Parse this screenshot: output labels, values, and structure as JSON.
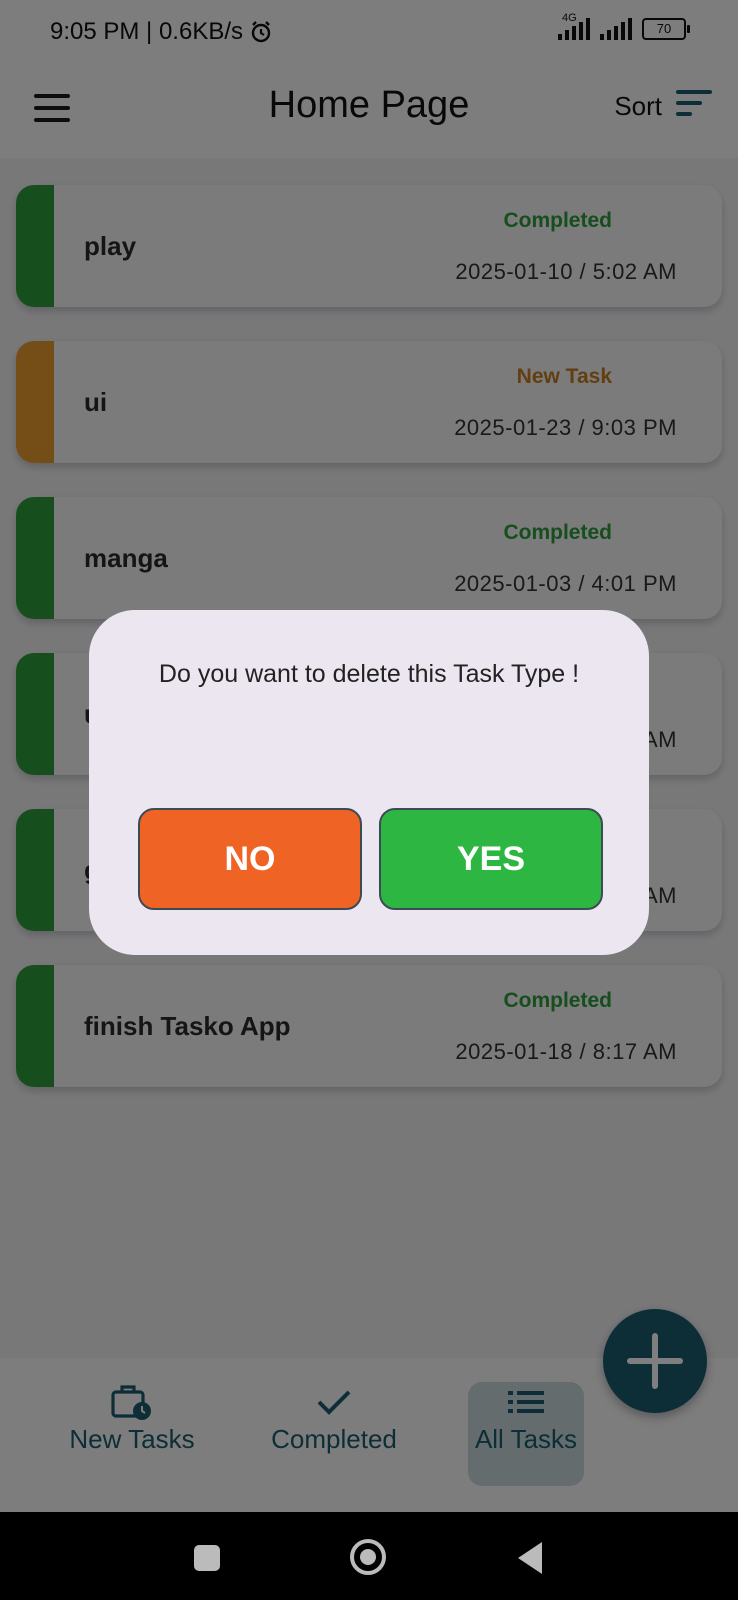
{
  "status_bar": {
    "time_speed": "9:05 PM | 0.6KB/s",
    "network": "4G",
    "battery": "70"
  },
  "app_bar": {
    "title": "Home Page",
    "sort_label": "Sort"
  },
  "tasks": [
    {
      "title": "play",
      "status": "Completed",
      "date": "2025-01-10  /  5:02 AM",
      "color": "#2e9c3a"
    },
    {
      "title": "ui",
      "status": "New Task",
      "date": "2025-01-23  /  9:03 PM",
      "color": "#e89a2e"
    },
    {
      "title": "manga",
      "status": "Completed",
      "date": "2025-01-03  /  4:01 PM",
      "color": "#2e9c3a"
    },
    {
      "title": "u",
      "status": "",
      "date": "AM",
      "color": "#2e9c3a"
    },
    {
      "title": "g",
      "status": "",
      "date": "AM",
      "color": "#2e9c3a"
    },
    {
      "title": "finish Tasko App",
      "status": "Completed",
      "date": "2025-01-18  /  8:17 AM",
      "color": "#2e9c3a"
    }
  ],
  "status_colors": {
    "completed": "#2e9c3a",
    "new_task": "#c57f21"
  },
  "dialog": {
    "message": "Do you want to delete this Task Type !",
    "no_label": "NO",
    "yes_label": "YES"
  },
  "bottom_nav": {
    "new_tasks_label": "New Tasks",
    "completed_label": "Completed",
    "all_tasks_label": "All Tasks",
    "active": "All Tasks"
  },
  "icons": {
    "menu": "menu-icon",
    "sort": "sort-icon",
    "alarm": "alarm-icon",
    "new_tasks": "briefcase-clock-icon",
    "completed": "check-icon",
    "all_tasks": "list-icon",
    "fab": "plus-icon"
  }
}
